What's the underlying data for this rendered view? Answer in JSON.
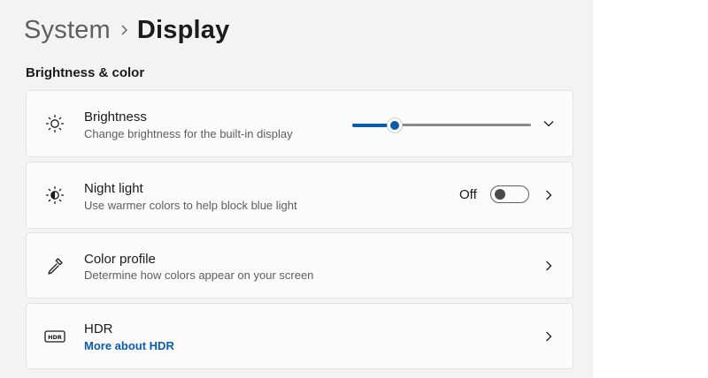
{
  "breadcrumb": {
    "parent": "System",
    "current": "Display"
  },
  "section": {
    "title": "Brightness & color"
  },
  "cards": {
    "brightness": {
      "title": "Brightness",
      "desc": "Change brightness for the built-in display",
      "value": 0.24
    },
    "night_light": {
      "title": "Night light",
      "desc": "Use warmer colors to help block blue light",
      "state": "Off"
    },
    "color_profile": {
      "title": "Color profile",
      "desc": "Determine how colors appear on your screen"
    },
    "hdr": {
      "title": "HDR",
      "link": "More about HDR"
    }
  },
  "icons": {
    "brightness": "sun-icon",
    "night_light": "half-sun-icon",
    "color_profile": "eyedropper-icon",
    "hdr": "hdr-icon"
  },
  "colors": {
    "accent": "#0a5cae",
    "background": "#f3f3f3",
    "card": "#fbfbfb"
  }
}
